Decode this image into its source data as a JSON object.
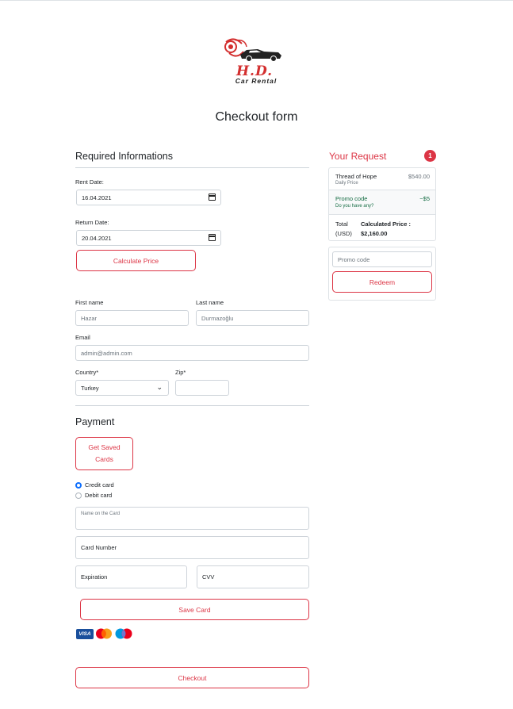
{
  "brand": {
    "logo_text": "H.D.",
    "logo_subtext": "Car Rental",
    "accent_color": "#dc3545"
  },
  "page_title": "Checkout form",
  "required": {
    "title": "Required Informations",
    "rent_date_label": "Rent Date:",
    "rent_date_value": "16.04.2021",
    "return_date_label": "Return Date:",
    "return_date_value": "20.04.2021",
    "calculate_label": "Calculate Price"
  },
  "customer": {
    "first_name_label": "First name",
    "first_name_value": "Hazar",
    "last_name_label": "Last name",
    "last_name_value": "Durmazoğlu",
    "email_label": "Email",
    "email_value": "admin@admin.com",
    "country_label": "Country*",
    "country_value": "Turkey",
    "zip_label": "Zip*",
    "zip_value": ""
  },
  "payment": {
    "title": "Payment",
    "saved_cards_label": "Get Saved Cards",
    "options": [
      "Credit card",
      "Debit card"
    ],
    "selected": "Credit card",
    "name_on_card_placeholder": "Name on the Card",
    "card_number_placeholder": "Card Number",
    "expiration_placeholder": "Expiration",
    "cvv_placeholder": "CVV",
    "save_card_label": "Save Card",
    "card_icons": [
      "visa-icon",
      "mastercard-icon",
      "maestro-icon"
    ],
    "visa_text": "VISA"
  },
  "checkout_label": "Checkout",
  "sidebar": {
    "title": "Your Request",
    "badge_count": "1",
    "item": {
      "name": "Thread of Hope",
      "sub": "Daily Price",
      "price": "$540.00"
    },
    "promo": {
      "name": "Promo code",
      "sub": "Do you have any?",
      "amount": "−$5"
    },
    "total": {
      "label": "Total",
      "currency": "(USD)",
      "calc_label": "Calculated Price :",
      "calc_value": "$2,160.00"
    },
    "promo_input_placeholder": "Promo code",
    "redeem_label": "Redeem"
  }
}
